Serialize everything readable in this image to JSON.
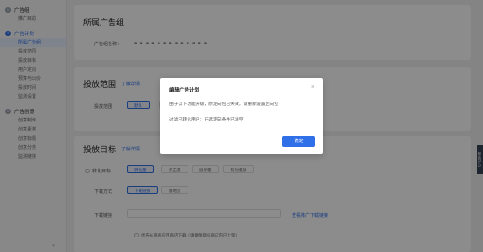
{
  "sidebar": {
    "groups": [
      {
        "num": "1",
        "title": "广告组",
        "active": false,
        "items": [
          "推广目的"
        ]
      },
      {
        "num": "2",
        "title": "广告计划",
        "active": true,
        "items": [
          "所属广告组",
          "投放范围",
          "投放目标",
          "用户定向",
          "预算与出价",
          "投放时间",
          "监测设置"
        ]
      },
      {
        "num": "3",
        "title": "广告创意",
        "active": false,
        "items": [
          "创意制作",
          "创意素材",
          "创意标题",
          "创意分类",
          "监测链接"
        ]
      }
    ],
    "collapse_icon": "«"
  },
  "section1": {
    "title": "所属广告组",
    "row_label": "广告组名称：",
    "masked_value": "■  ■ ■ ■ ■ ■ ■ ■ ■ ■ ■ ■ ■"
  },
  "section2": {
    "title": "投放范围",
    "link": "了解详情",
    "row_label": "投放范围",
    "chips": [
      "默认",
      "穿山甲"
    ]
  },
  "section3": {
    "title": "投放目标",
    "link": "了解详情",
    "row1_label": "转化目标",
    "row1_chips": [
      "转化量",
      "点击量",
      "展示量",
      "有效播放"
    ],
    "row2_label": "下载方式",
    "row2_chips": [
      "下载链接",
      "落地页"
    ],
    "row3_label": "下载链接",
    "row3_link": "查看推广下载链接",
    "bottom_text": "优先从系统应用商店下载（请确保目标商店内已上架）"
  },
  "side_tab": {
    "label": "帮助中心"
  },
  "modal": {
    "title": "编辑广告计划",
    "close_icon": "×",
    "line1": "由于以下功能升级，原定向包已失效，请重新设置定向包",
    "line2": "过滤已转化用户：已选定向条件已清空",
    "confirm": "确定"
  }
}
